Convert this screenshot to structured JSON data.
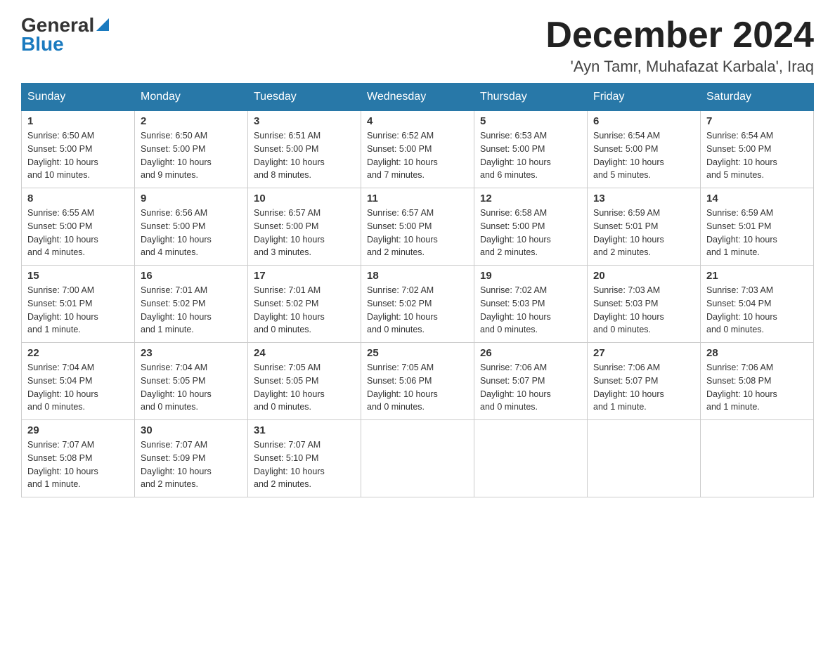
{
  "header": {
    "logo_general": "General",
    "logo_blue": "Blue",
    "month_title": "December 2024",
    "location": "'Ayn Tamr, Muhafazat Karbala', Iraq"
  },
  "days_of_week": [
    "Sunday",
    "Monday",
    "Tuesday",
    "Wednesday",
    "Thursday",
    "Friday",
    "Saturday"
  ],
  "weeks": [
    [
      {
        "day": "1",
        "sunrise": "6:50 AM",
        "sunset": "5:00 PM",
        "daylight": "10 hours and 10 minutes."
      },
      {
        "day": "2",
        "sunrise": "6:50 AM",
        "sunset": "5:00 PM",
        "daylight": "10 hours and 9 minutes."
      },
      {
        "day": "3",
        "sunrise": "6:51 AM",
        "sunset": "5:00 PM",
        "daylight": "10 hours and 8 minutes."
      },
      {
        "day": "4",
        "sunrise": "6:52 AM",
        "sunset": "5:00 PM",
        "daylight": "10 hours and 7 minutes."
      },
      {
        "day": "5",
        "sunrise": "6:53 AM",
        "sunset": "5:00 PM",
        "daylight": "10 hours and 6 minutes."
      },
      {
        "day": "6",
        "sunrise": "6:54 AM",
        "sunset": "5:00 PM",
        "daylight": "10 hours and 5 minutes."
      },
      {
        "day": "7",
        "sunrise": "6:54 AM",
        "sunset": "5:00 PM",
        "daylight": "10 hours and 5 minutes."
      }
    ],
    [
      {
        "day": "8",
        "sunrise": "6:55 AM",
        "sunset": "5:00 PM",
        "daylight": "10 hours and 4 minutes."
      },
      {
        "day": "9",
        "sunrise": "6:56 AM",
        "sunset": "5:00 PM",
        "daylight": "10 hours and 4 minutes."
      },
      {
        "day": "10",
        "sunrise": "6:57 AM",
        "sunset": "5:00 PM",
        "daylight": "10 hours and 3 minutes."
      },
      {
        "day": "11",
        "sunrise": "6:57 AM",
        "sunset": "5:00 PM",
        "daylight": "10 hours and 2 minutes."
      },
      {
        "day": "12",
        "sunrise": "6:58 AM",
        "sunset": "5:00 PM",
        "daylight": "10 hours and 2 minutes."
      },
      {
        "day": "13",
        "sunrise": "6:59 AM",
        "sunset": "5:01 PM",
        "daylight": "10 hours and 2 minutes."
      },
      {
        "day": "14",
        "sunrise": "6:59 AM",
        "sunset": "5:01 PM",
        "daylight": "10 hours and 1 minute."
      }
    ],
    [
      {
        "day": "15",
        "sunrise": "7:00 AM",
        "sunset": "5:01 PM",
        "daylight": "10 hours and 1 minute."
      },
      {
        "day": "16",
        "sunrise": "7:01 AM",
        "sunset": "5:02 PM",
        "daylight": "10 hours and 1 minute."
      },
      {
        "day": "17",
        "sunrise": "7:01 AM",
        "sunset": "5:02 PM",
        "daylight": "10 hours and 0 minutes."
      },
      {
        "day": "18",
        "sunrise": "7:02 AM",
        "sunset": "5:02 PM",
        "daylight": "10 hours and 0 minutes."
      },
      {
        "day": "19",
        "sunrise": "7:02 AM",
        "sunset": "5:03 PM",
        "daylight": "10 hours and 0 minutes."
      },
      {
        "day": "20",
        "sunrise": "7:03 AM",
        "sunset": "5:03 PM",
        "daylight": "10 hours and 0 minutes."
      },
      {
        "day": "21",
        "sunrise": "7:03 AM",
        "sunset": "5:04 PM",
        "daylight": "10 hours and 0 minutes."
      }
    ],
    [
      {
        "day": "22",
        "sunrise": "7:04 AM",
        "sunset": "5:04 PM",
        "daylight": "10 hours and 0 minutes."
      },
      {
        "day": "23",
        "sunrise": "7:04 AM",
        "sunset": "5:05 PM",
        "daylight": "10 hours and 0 minutes."
      },
      {
        "day": "24",
        "sunrise": "7:05 AM",
        "sunset": "5:05 PM",
        "daylight": "10 hours and 0 minutes."
      },
      {
        "day": "25",
        "sunrise": "7:05 AM",
        "sunset": "5:06 PM",
        "daylight": "10 hours and 0 minutes."
      },
      {
        "day": "26",
        "sunrise": "7:06 AM",
        "sunset": "5:07 PM",
        "daylight": "10 hours and 0 minutes."
      },
      {
        "day": "27",
        "sunrise": "7:06 AM",
        "sunset": "5:07 PM",
        "daylight": "10 hours and 1 minute."
      },
      {
        "day": "28",
        "sunrise": "7:06 AM",
        "sunset": "5:08 PM",
        "daylight": "10 hours and 1 minute."
      }
    ],
    [
      {
        "day": "29",
        "sunrise": "7:07 AM",
        "sunset": "5:08 PM",
        "daylight": "10 hours and 1 minute."
      },
      {
        "day": "30",
        "sunrise": "7:07 AM",
        "sunset": "5:09 PM",
        "daylight": "10 hours and 2 minutes."
      },
      {
        "day": "31",
        "sunrise": "7:07 AM",
        "sunset": "5:10 PM",
        "daylight": "10 hours and 2 minutes."
      },
      null,
      null,
      null,
      null
    ]
  ],
  "labels": {
    "sunrise": "Sunrise:",
    "sunset": "Sunset:",
    "daylight": "Daylight:"
  }
}
